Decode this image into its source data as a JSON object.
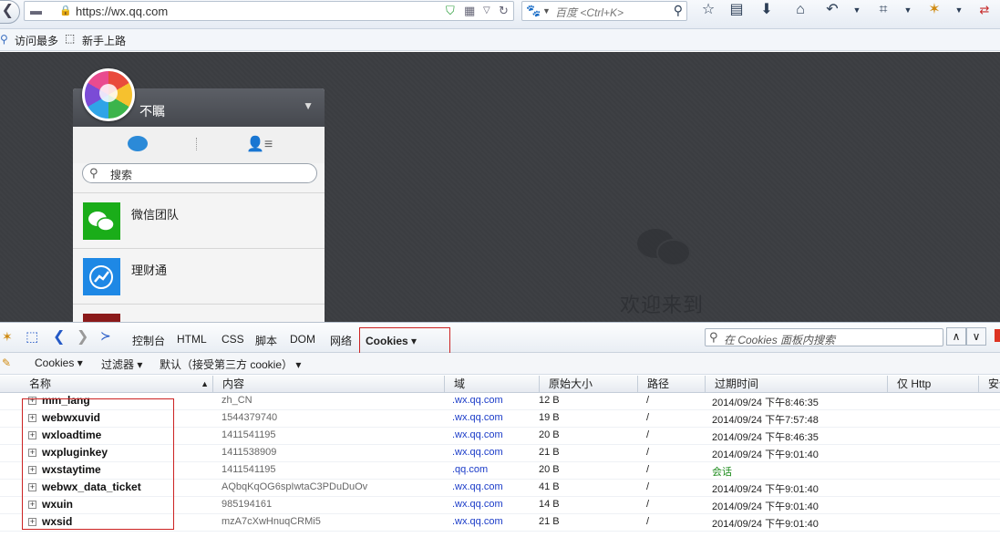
{
  "browser": {
    "url": "https://wx.qq.com",
    "search_placeholder": "百度 <Ctrl+K>"
  },
  "bookmarks": [
    "访问最多",
    "新手上路"
  ],
  "page": {
    "user_name": "不瞩",
    "search_placeholder": "搜索",
    "chats": [
      {
        "name": "微信团队",
        "color": "#1aad19"
      },
      {
        "name": "理财通",
        "color": "#1e88e5"
      },
      {
        "name": "",
        "color": "#8b1a1a"
      }
    ],
    "welcome": "欢迎来到"
  },
  "firebug": {
    "tabs": [
      "控制台",
      "HTML",
      "CSS",
      "脚本",
      "DOM",
      "网络"
    ],
    "active_tab": "Cookies ▾",
    "search_placeholder": "在 Cookies 面板内搜索",
    "sub_items": [
      "Cookies ▾",
      "过滤器 ▾",
      "默认（接受第三方 cookie） ▾"
    ],
    "columns": [
      "名称",
      "内容",
      "域",
      "原始大小",
      "路径",
      "过期时间",
      "仅 Http",
      "安全"
    ],
    "rows": [
      {
        "name": "mm_lang",
        "value": "zh_CN",
        "domain": ".wx.qq.com",
        "size": "12 B",
        "path": "/",
        "expires": "2014/09/24 下午8:46:35"
      },
      {
        "name": "webwxuvid",
        "value": "1544379740",
        "domain": ".wx.qq.com",
        "size": "19 B",
        "path": "/",
        "expires": "2014/09/24 下午7:57:48"
      },
      {
        "name": "wxloadtime",
        "value": "1411541195",
        "domain": ".wx.qq.com",
        "size": "20 B",
        "path": "/",
        "expires": "2014/09/24 下午8:46:35"
      },
      {
        "name": "wxpluginkey",
        "value": "1411538909",
        "domain": ".wx.qq.com",
        "size": "21 B",
        "path": "/",
        "expires": "2014/09/24 下午9:01:40"
      },
      {
        "name": "wxstaytime",
        "value": "1411541195",
        "domain": ".qq.com",
        "size": "20 B",
        "path": "/",
        "expires": "会话"
      },
      {
        "name": "webwx_data_ticket",
        "value": "AQbqKqOG6spIwtaC3PDuDuOv",
        "domain": ".wx.qq.com",
        "size": "41 B",
        "path": "/",
        "expires": "2014/09/24 下午9:01:40"
      },
      {
        "name": "wxuin",
        "value": "985194161",
        "domain": ".wx.qq.com",
        "size": "14 B",
        "path": "/",
        "expires": "2014/09/24 下午9:01:40"
      },
      {
        "name": "wxsid",
        "value": "mzA7cXwHnuqCRMi5",
        "domain": ".wx.qq.com",
        "size": "21 B",
        "path": "/",
        "expires": "2014/09/24 下午9:01:40"
      }
    ],
    "session_color": "#1a8a1a"
  }
}
